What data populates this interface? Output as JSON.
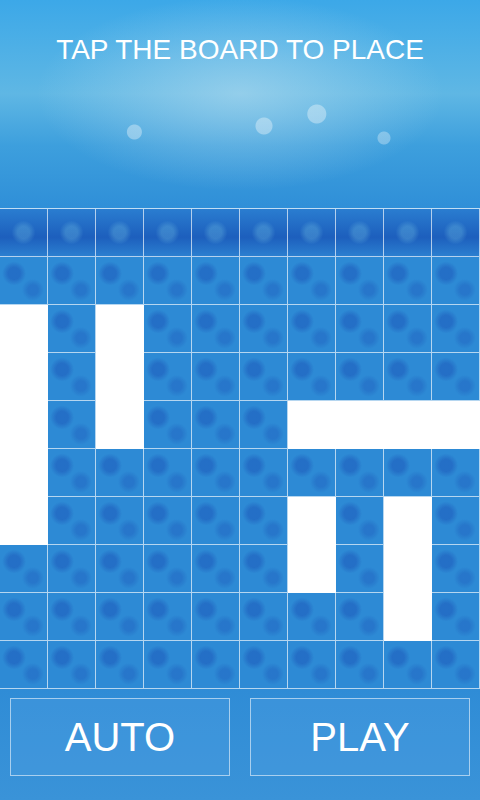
{
  "title": "TAP THE BOARD TO PLACE",
  "board": {
    "empty_by_row": [
      [
        false,
        false,
        false,
        false,
        false,
        false,
        false,
        false,
        false,
        false
      ],
      [
        false,
        false,
        false,
        false,
        false,
        false,
        false,
        false,
        false,
        false
      ],
      [
        true,
        false,
        true,
        false,
        false,
        false,
        false,
        false,
        false,
        false
      ],
      [
        true,
        false,
        true,
        false,
        false,
        false,
        false,
        false,
        false,
        false
      ],
      [
        true,
        false,
        true,
        false,
        false,
        false,
        true,
        true,
        true,
        true
      ],
      [
        true,
        false,
        false,
        false,
        false,
        false,
        false,
        false,
        false,
        false
      ],
      [
        true,
        false,
        false,
        false,
        false,
        false,
        true,
        false,
        true,
        false
      ],
      [
        false,
        false,
        false,
        false,
        false,
        false,
        true,
        false,
        true,
        false
      ],
      [
        false,
        false,
        false,
        false,
        false,
        false,
        false,
        false,
        true,
        false
      ],
      [
        false,
        false,
        false,
        false,
        false,
        false,
        false,
        false,
        false,
        false
      ]
    ]
  },
  "buttons": [
    "AUTO",
    "PLAY"
  ]
}
